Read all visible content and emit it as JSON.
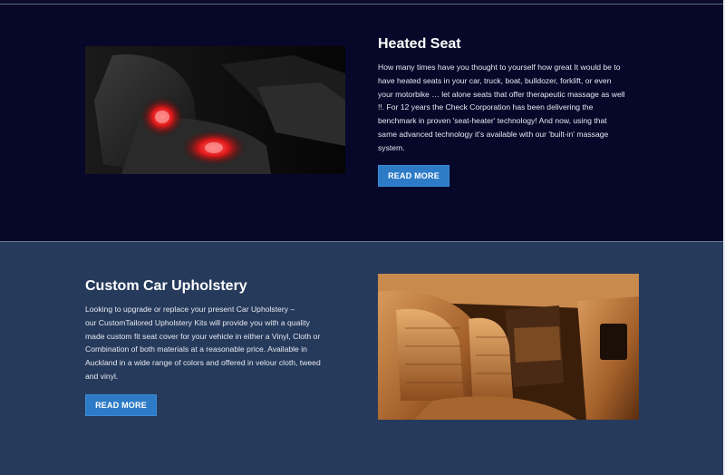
{
  "heated": {
    "title": "Heated Seat",
    "lines": [
      "How many times have you thought to yourself how great It would be to",
      "have heated seats in your car, truck, boat, bulldozer, forklift, or even",
      "your motorbike … let alone seats that offer therapeutic massage as well",
      "!!. For 12 years the Check Corporation has been delivering the",
      "benchmark in proven 'seat-heater' technology! And now, using that",
      "same advanced technology it's available with our 'built-in' massage",
      "system."
    ],
    "button": "READ MORE",
    "image_desc": "heated-car-seat-image"
  },
  "upholstery": {
    "title": "Custom Car Upholstery",
    "lines": [
      "Looking to upgrade or replace your present Car Upholstery –",
      "our CustomTailored Upholstery Kits will provide you with a quality",
      "made custom fit seat cover for your vehicle in either a Vinyl, Cloth or",
      "Combination of both materials at a reasonable price. Available in",
      "Auckland in a wide range of colors and offered in velour cloth, tweed",
      "and vinyl."
    ],
    "button": "READ MORE",
    "image_desc": "leather-car-interior-image"
  },
  "colors": {
    "dark_section": "#070729",
    "light_section": "#263a5c",
    "button": "#2d7bc6"
  }
}
